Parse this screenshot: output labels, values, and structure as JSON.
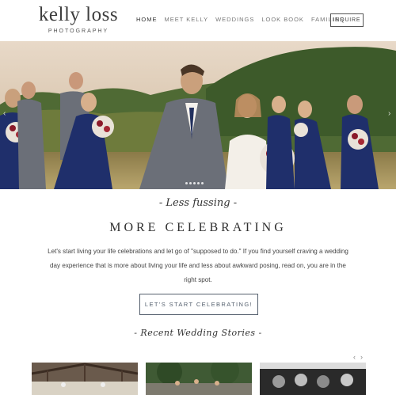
{
  "brand": {
    "name": "kelly loss",
    "subtitle": "PHOTOGRAPHY"
  },
  "nav": {
    "items": [
      {
        "label": "HOME"
      },
      {
        "label": "MEET KELLY"
      },
      {
        "label": "WEDDINGS"
      },
      {
        "label": "LOOK BOOK"
      },
      {
        "label": "FAMILIES"
      }
    ],
    "inquire_label": "INQUIRE"
  },
  "hero": {
    "prev_icon": "chevron-left-icon",
    "next_icon": "chevron-right-icon",
    "slide_count": 5
  },
  "intro": {
    "script_tagline": "- Less fussing -",
    "heading": "MORE CELEBRATING",
    "paragraph": "Let's start living your life celebrations and let go of \"supposed to do.\"  If you find yourself craving a wedding day experience that is more about living your life and less about awkward posing, read on, you are in the right spot.",
    "cta_label": "LET'S START CELEBRATING!"
  },
  "stories": {
    "title": "- Recent Wedding Stories -",
    "prev_label": "‹",
    "next_label": "›"
  },
  "colors": {
    "accent": "#55606e",
    "dress_navy": "#1f2f6b",
    "suit_gray": "#6b6f78"
  }
}
